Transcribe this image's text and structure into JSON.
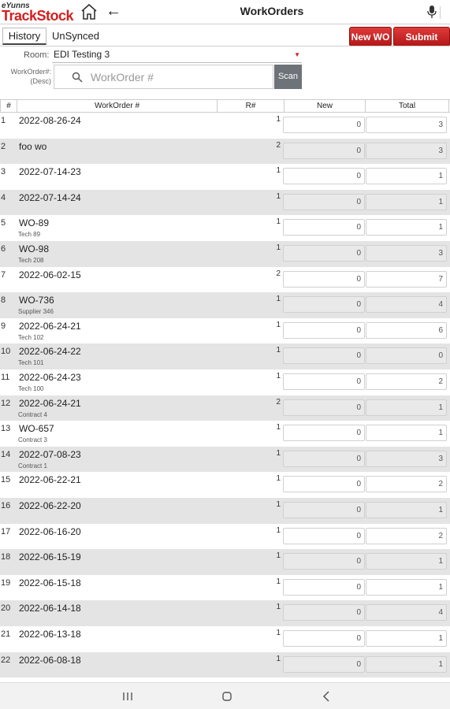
{
  "header": {
    "brand_small": "eYunns",
    "brand_big": "TrackStock",
    "title": "WorkOrders",
    "icons": [
      "home-icon",
      "back-arrow-icon",
      "mic-icon"
    ]
  },
  "tabs": {
    "history": "History",
    "unsynced": "UnSynced"
  },
  "buttons": {
    "new_wo": "New WO",
    "submit_wos": "Submit WOs",
    "scan": "Scan"
  },
  "room": {
    "label": "Room:",
    "value": "EDI Testing 3"
  },
  "search": {
    "label_line1": "WorkOrder#:",
    "label_line2": "(Desc)",
    "placeholder": "WorkOrder #"
  },
  "table": {
    "headers": {
      "num": "#",
      "workorder": "WorkOrder #",
      "r": "R#",
      "new": "New",
      "total": "Total"
    },
    "rows": [
      {
        "num": "1",
        "wo": "2022-08-26-24",
        "desc": "",
        "r": "1",
        "new": "0",
        "total": "3"
      },
      {
        "num": "2",
        "wo": "foo wo",
        "desc": "",
        "r": "2",
        "new": "0",
        "total": "3"
      },
      {
        "num": "3",
        "wo": "2022-07-14-23",
        "desc": "",
        "r": "1",
        "new": "0",
        "total": "1"
      },
      {
        "num": "4",
        "wo": "2022-07-14-24",
        "desc": "",
        "r": "1",
        "new": "0",
        "total": "1"
      },
      {
        "num": "5",
        "wo": "WO-89",
        "desc": "Tech 89",
        "r": "1",
        "new": "0",
        "total": "1"
      },
      {
        "num": "6",
        "wo": "WO-98",
        "desc": "Tech 208",
        "r": "1",
        "new": "0",
        "total": "3"
      },
      {
        "num": "7",
        "wo": "2022-06-02-15",
        "desc": "",
        "r": "2",
        "new": "0",
        "total": "7"
      },
      {
        "num": "8",
        "wo": "WO-736",
        "desc": "Supplier 346",
        "r": "1",
        "new": "0",
        "total": "4"
      },
      {
        "num": "9",
        "wo": "2022-06-24-21",
        "desc": "Tech 102",
        "r": "1",
        "new": "0",
        "total": "6"
      },
      {
        "num": "10",
        "wo": "2022-06-24-22",
        "desc": "Tech 101",
        "r": "1",
        "new": "0",
        "total": "0"
      },
      {
        "num": "11",
        "wo": "2022-06-24-23",
        "desc": "Tech 100",
        "r": "1",
        "new": "0",
        "total": "2"
      },
      {
        "num": "12",
        "wo": "2022-06-24-21",
        "desc": "Contract 4",
        "r": "2",
        "new": "0",
        "total": "1"
      },
      {
        "num": "13",
        "wo": "WO-657",
        "desc": "Contract 3",
        "r": "1",
        "new": "0",
        "total": "1"
      },
      {
        "num": "14",
        "wo": "2022-07-08-23",
        "desc": "Contract 1",
        "r": "1",
        "new": "0",
        "total": "3"
      },
      {
        "num": "15",
        "wo": "2022-06-22-21",
        "desc": "",
        "r": "1",
        "new": "0",
        "total": "2"
      },
      {
        "num": "16",
        "wo": "2022-06-22-20",
        "desc": "",
        "r": "1",
        "new": "0",
        "total": "1"
      },
      {
        "num": "17",
        "wo": "2022-06-16-20",
        "desc": "",
        "r": "1",
        "new": "0",
        "total": "2"
      },
      {
        "num": "18",
        "wo": "2022-06-15-19",
        "desc": "",
        "r": "1",
        "new": "0",
        "total": "1"
      },
      {
        "num": "19",
        "wo": "2022-06-15-18",
        "desc": "",
        "r": "1",
        "new": "0",
        "total": "1"
      },
      {
        "num": "20",
        "wo": "2022-06-14-18",
        "desc": "",
        "r": "1",
        "new": "0",
        "total": "4"
      },
      {
        "num": "21",
        "wo": "2022-06-13-18",
        "desc": "",
        "r": "1",
        "new": "0",
        "total": "1"
      },
      {
        "num": "22",
        "wo": "2022-06-08-18",
        "desc": "",
        "r": "1",
        "new": "0",
        "total": "1"
      }
    ]
  },
  "navbar": {
    "icons": [
      "recents-icon",
      "home-circle-icon",
      "nav-back-icon"
    ]
  },
  "colors": {
    "brand_red": "#d32020",
    "button_red": "#c62828",
    "scan_gray": "#6d7378",
    "row_shade": "#e4e4e4"
  }
}
